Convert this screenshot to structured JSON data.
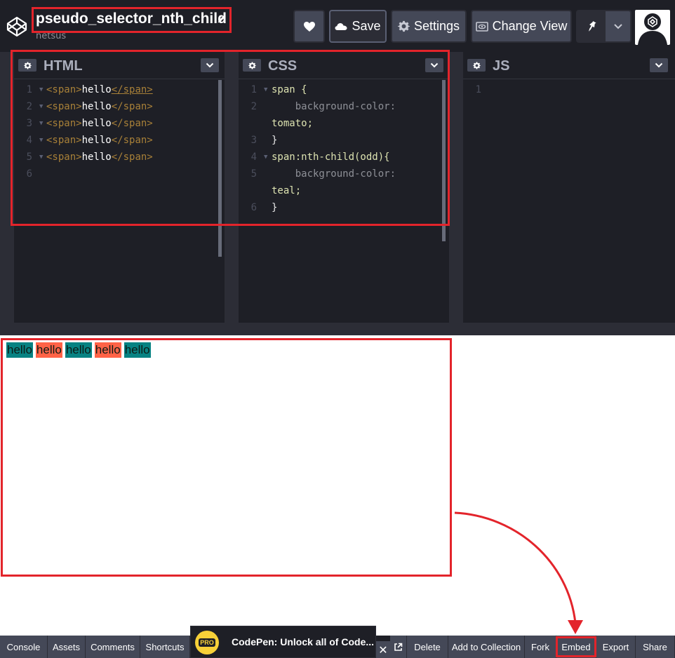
{
  "header": {
    "title": "pseudo_selector_nth_child",
    "author": "netsus",
    "buttons": {
      "save": "Save",
      "settings": "Settings",
      "change_view": "Change View"
    },
    "icons": [
      "codepen-logo-icon",
      "pencil-icon",
      "heart-icon",
      "cloud-icon",
      "gear-icon",
      "eye-icon",
      "pin-icon",
      "chevron-down-icon",
      "avatar-icon"
    ]
  },
  "editors": {
    "html": {
      "title": "HTML",
      "line_numbers": [
        "1",
        "2",
        "3",
        "4",
        "5",
        "6"
      ],
      "open_tag": "<span>",
      "content": "hello",
      "close_tag": "</span>"
    },
    "css": {
      "title": "CSS",
      "line_numbers": [
        "1",
        "2",
        "",
        "3",
        "4",
        "5",
        "",
        "6"
      ],
      "lines": [
        "span {",
        "    background-color:",
        "tomato;",
        "}",
        "span:nth-child(odd){",
        "    background-color:",
        "teal;",
        "}"
      ]
    },
    "js": {
      "title": "JS",
      "line_numbers": [
        "1"
      ]
    }
  },
  "preview": {
    "spans": [
      {
        "text": "hello",
        "color": "#078282"
      },
      {
        "text": "hello",
        "color": "#ff6347"
      },
      {
        "text": "hello",
        "color": "#078282"
      },
      {
        "text": "hello",
        "color": "#ff6347"
      },
      {
        "text": "hello",
        "color": "#078282"
      }
    ]
  },
  "footer": {
    "console": "Console",
    "assets": "Assets",
    "comments": "Comments",
    "shortcuts": "Shortcuts",
    "promo_badge": "PRO",
    "promo_text": "CodePen: Unlock all of Code...",
    "close": "✕",
    "delete": "Delete",
    "add_to_collection": "Add to Collection",
    "fork": "Fork",
    "embed": "Embed",
    "export": "Export",
    "share": "Share"
  },
  "colors": {
    "annotation_red": "#e3242b",
    "header_bg": "#1e1f26",
    "button_bg": "#444857"
  }
}
